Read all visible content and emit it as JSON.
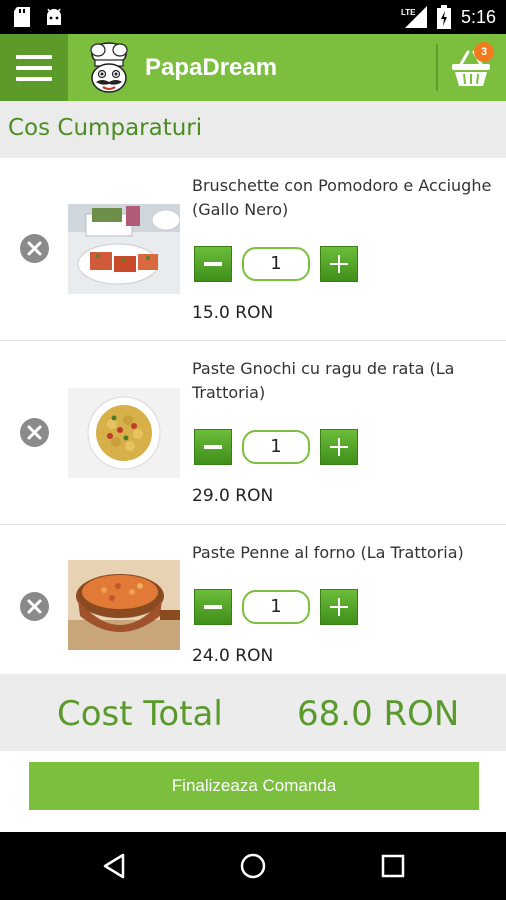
{
  "status_bar": {
    "time": "5:16",
    "network": "LTE",
    "icons": [
      "sd-card-icon",
      "android-icon",
      "signal-icon",
      "battery-charging-icon"
    ]
  },
  "app_bar": {
    "title": "PapaDream",
    "cart_count": "3",
    "icons": [
      "menu-icon",
      "chef-logo",
      "shopping-basket-icon"
    ]
  },
  "page": {
    "title": "Cos Cumparaturi"
  },
  "cart": {
    "items": [
      {
        "name": "Bruschette con Pomodoro e Acciughe (Gallo Nero)",
        "quantity": "1",
        "price": "15.0 RON"
      },
      {
        "name": "Paste Gnochi cu ragu de rata (La Trattoria)",
        "quantity": "1",
        "price": "29.0 RON"
      },
      {
        "name": "Paste Penne al forno (La Trattoria)",
        "quantity": "1",
        "price": "24.0 RON"
      }
    ]
  },
  "summary": {
    "total_label": "Cost Total",
    "total_value": "68.0 RON"
  },
  "checkout": {
    "label": "Finalizeaza Comanda"
  },
  "nav": {
    "icons": [
      "back-icon",
      "home-icon",
      "recents-icon"
    ]
  },
  "colors": {
    "brand_green": "#7cbf3f",
    "dark_green": "#5c9a2a",
    "title_green": "#4a8e22",
    "badge_orange": "#f07b1f"
  }
}
